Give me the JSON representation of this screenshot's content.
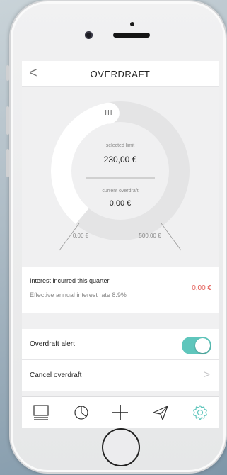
{
  "header": {
    "back_glyph": "<",
    "title": "OVERDRAFT"
  },
  "gauge": {
    "handle_glyph": "III",
    "selected_limit_label": "selected limit",
    "selected_limit_value": "230,00 €",
    "current_overdraft_label": "current overdraft",
    "current_overdraft_value": "0,00 €",
    "min_label": "0,00 €",
    "max_label": "500,00 €",
    "selected_fraction": 0.46
  },
  "interest": {
    "title": "Interest incurred this quarter",
    "subtitle": "Effective annual interest rate 8.9%",
    "value": "0,00 €"
  },
  "settings": {
    "alert_label": "Overdraft alert",
    "alert_on": true,
    "cancel_label": "Cancel overdraft",
    "chevron_glyph": ">"
  },
  "tabbar": {
    "tabs": [
      "list-icon",
      "clock-icon",
      "plus-icon",
      "send-icon",
      "gear-icon"
    ],
    "active_tab": "gear-icon"
  },
  "colors": {
    "accent": "#5fc6bc",
    "negative": "#e2554e",
    "active_tab": "#5fc6bc"
  }
}
